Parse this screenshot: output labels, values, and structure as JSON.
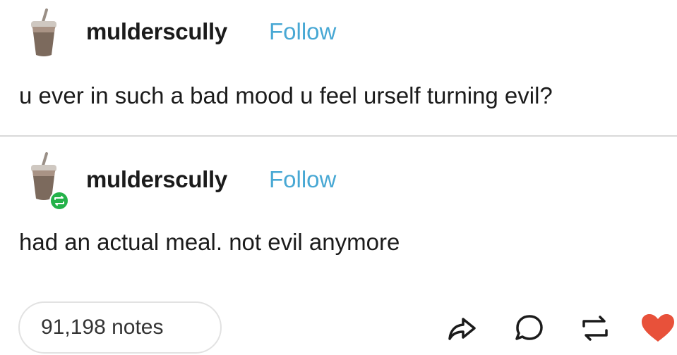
{
  "original_post": {
    "username": "mulderscully",
    "follow_label": "Follow",
    "text": "u ever in such a bad mood u feel urself turning evil?"
  },
  "reblog": {
    "username": "mulderscully",
    "follow_label": "Follow",
    "text": "had an actual meal. not evil anymore"
  },
  "footer": {
    "notes_label": "91,198 notes"
  },
  "icons": {
    "avatar": "iced-coffee-cup-icon",
    "reblog_badge": "reblog-badge-icon",
    "share": "share-icon",
    "reply": "reply-icon",
    "reblog": "reblog-icon",
    "like": "heart-icon"
  },
  "colors": {
    "follow": "#48a8d4",
    "heart": "#e8513a",
    "reblog_badge": "#24b24a",
    "divider": "#d9d9d9"
  }
}
